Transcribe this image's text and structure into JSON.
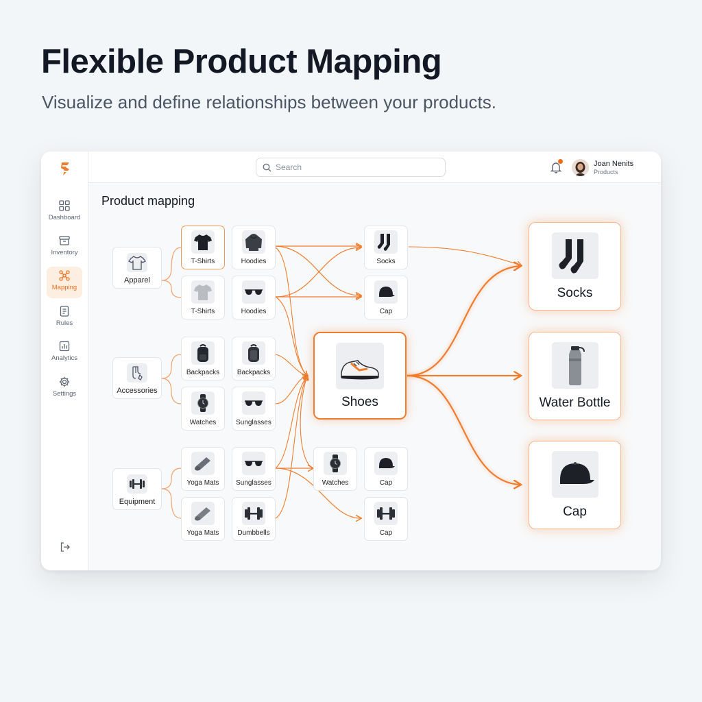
{
  "hero": {
    "title": "Flexible Product Mapping",
    "subtitle": "Visualize and define relationships between your products."
  },
  "theme": {
    "accent": "#f07c2d",
    "accent_light": "#fdeee2"
  },
  "sidebar": {
    "logo_icon": "brand-s-logo",
    "items": [
      {
        "label": "Dashboard",
        "icon": "grid-icon",
        "active": false
      },
      {
        "label": "Inventory",
        "icon": "box-icon",
        "active": false
      },
      {
        "label": "Mapping",
        "icon": "network-icon",
        "active": true
      },
      {
        "label": "Rules",
        "icon": "document-icon",
        "active": false
      },
      {
        "label": "Analytics",
        "icon": "bar-chart-icon",
        "active": false
      },
      {
        "label": "Settings",
        "icon": "gear-icon",
        "active": false
      }
    ],
    "logout_icon": "logout-icon"
  },
  "topbar": {
    "search_placeholder": "Search",
    "notification_count": "!",
    "user": {
      "name": "Joan Nenits",
      "role": "Products"
    }
  },
  "content": {
    "title": "Product mapping",
    "groups": [
      {
        "label": "Apparel",
        "icon": "tshirt-outline-icon"
      },
      {
        "label": "Accessories",
        "icon": "accessories-icon"
      },
      {
        "label": "Equipment",
        "icon": "dumbbell-icon"
      }
    ],
    "sources": [
      {
        "label": "T-Shirts",
        "icon": "black-tshirt-icon",
        "highlight": true
      },
      {
        "label": "Hoodies",
        "icon": "hoodie-icon"
      },
      {
        "label": "T-Shirts",
        "icon": "grey-tshirt-icon"
      },
      {
        "label": "Hoodies",
        "icon": "sunglasses-icon"
      },
      {
        "label": "Backpacks",
        "icon": "backpack-icon"
      },
      {
        "label": "Backpacks",
        "icon": "backpack-icon"
      },
      {
        "label": "Watches",
        "icon": "watch-icon"
      },
      {
        "label": "Sunglasses",
        "icon": "sunglasses-icon"
      },
      {
        "label": "Yoga Mats",
        "icon": "yoga-mat-icon"
      },
      {
        "label": "Sunglasses",
        "icon": "sunglasses-icon"
      },
      {
        "label": "Yoga Mats",
        "icon": "yoga-mat-icon"
      },
      {
        "label": "Dumbbells",
        "icon": "dumbbell-icon"
      }
    ],
    "intermediates": [
      {
        "label": "Socks",
        "icon": "socks-icon"
      },
      {
        "label": "Cap",
        "icon": "cap-icon"
      },
      {
        "label": "Watches",
        "icon": "watch-icon"
      },
      {
        "label": "Cap",
        "icon": "cap-icon"
      },
      {
        "label": "Cap",
        "icon": "dumbbell-icon"
      }
    ],
    "hub": {
      "label": "Shoes",
      "icon": "sneaker-icon"
    },
    "targets": [
      {
        "label": "Socks",
        "icon": "socks-icon"
      },
      {
        "label": "Water Bottle",
        "icon": "water-bottle-icon"
      },
      {
        "label": "Cap",
        "icon": "cap-icon"
      }
    ]
  }
}
